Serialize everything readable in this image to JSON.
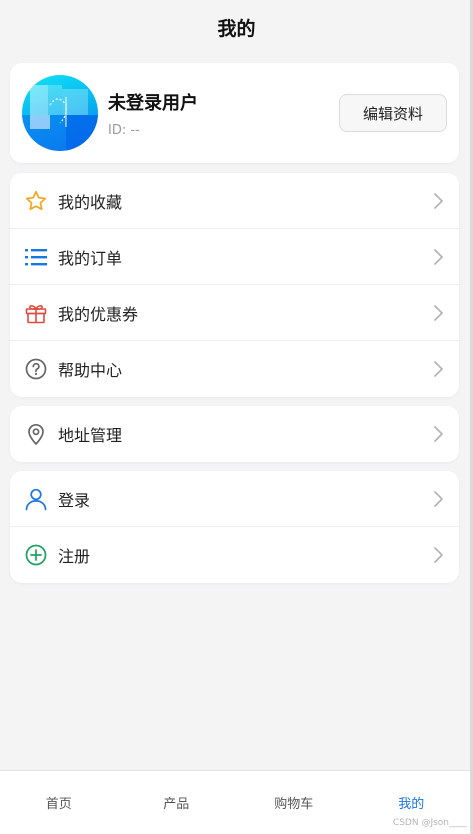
{
  "header": {
    "title": "我的"
  },
  "profile": {
    "username": "未登录用户",
    "id_text": "ID: --",
    "edit_label": "编辑资料"
  },
  "menu_groups": [
    {
      "items": [
        {
          "label": "我的收藏",
          "icon": "star-icon",
          "color": "#f5a623"
        },
        {
          "label": "我的订单",
          "icon": "list-icon",
          "color": "#1976e6"
        },
        {
          "label": "我的优惠券",
          "icon": "gift-icon",
          "color": "#e04b3c"
        },
        {
          "label": "帮助中心",
          "icon": "question-icon",
          "color": "#666666"
        }
      ]
    },
    {
      "items": [
        {
          "label": "地址管理",
          "icon": "location-pin-icon",
          "color": "#666666"
        }
      ]
    },
    {
      "items": [
        {
          "label": "登录",
          "icon": "user-icon",
          "color": "#1976e6"
        },
        {
          "label": "注册",
          "icon": "plus-circle-icon",
          "color": "#1aa260"
        }
      ]
    }
  ],
  "tabbar": {
    "tabs": [
      {
        "label": "首页",
        "active": false
      },
      {
        "label": "产品",
        "active": false
      },
      {
        "label": "购物车",
        "active": false
      },
      {
        "label": "我的",
        "active": true
      }
    ]
  },
  "watermark": "CSDN @Json____"
}
